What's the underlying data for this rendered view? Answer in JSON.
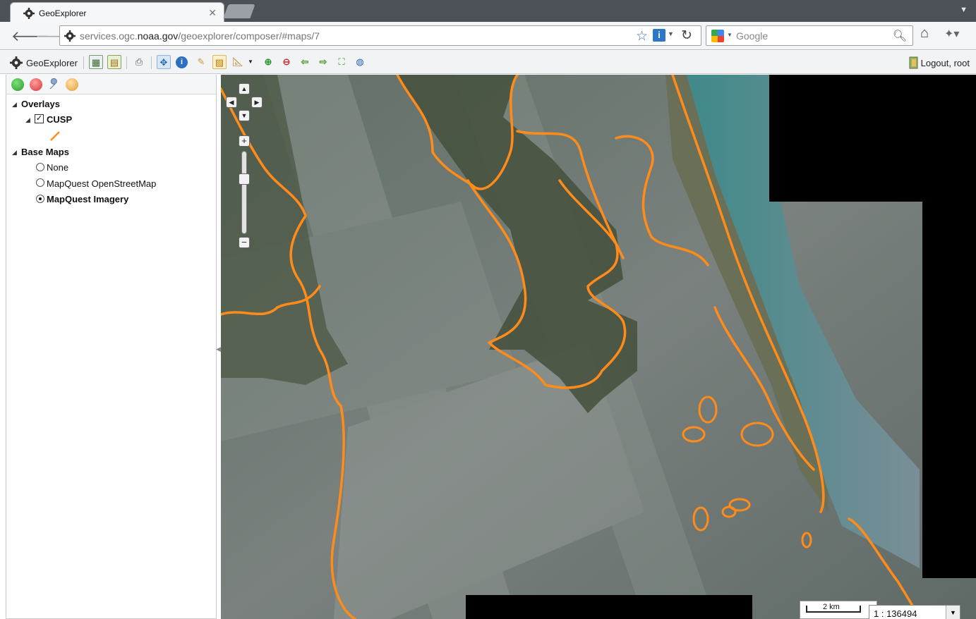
{
  "browser": {
    "tab_title": "GeoExplorer",
    "url_prefix": "services.ogc.",
    "url_host": "noaa.gov",
    "url_path": "/geoexplorer/composer/#maps/7",
    "search_engine": "Google"
  },
  "app": {
    "name": "GeoExplorer",
    "logout_label": "Logout, root"
  },
  "layers": {
    "overlays_label": "Overlays",
    "overlay_items": [
      {
        "label": "CUSP",
        "checked": true,
        "line_color": "#ff8c1a"
      }
    ],
    "basemaps_label": "Base Maps",
    "basemap_items": [
      {
        "label": "None",
        "selected": false
      },
      {
        "label": "MapQuest OpenStreetMap",
        "selected": false
      },
      {
        "label": "MapQuest Imagery",
        "selected": true
      }
    ]
  },
  "map": {
    "scale_bar_label": "2 km",
    "scale_value": "1 : 136494",
    "shoreline_color": "#ff8c1a",
    "nodata_color": "#000000"
  }
}
